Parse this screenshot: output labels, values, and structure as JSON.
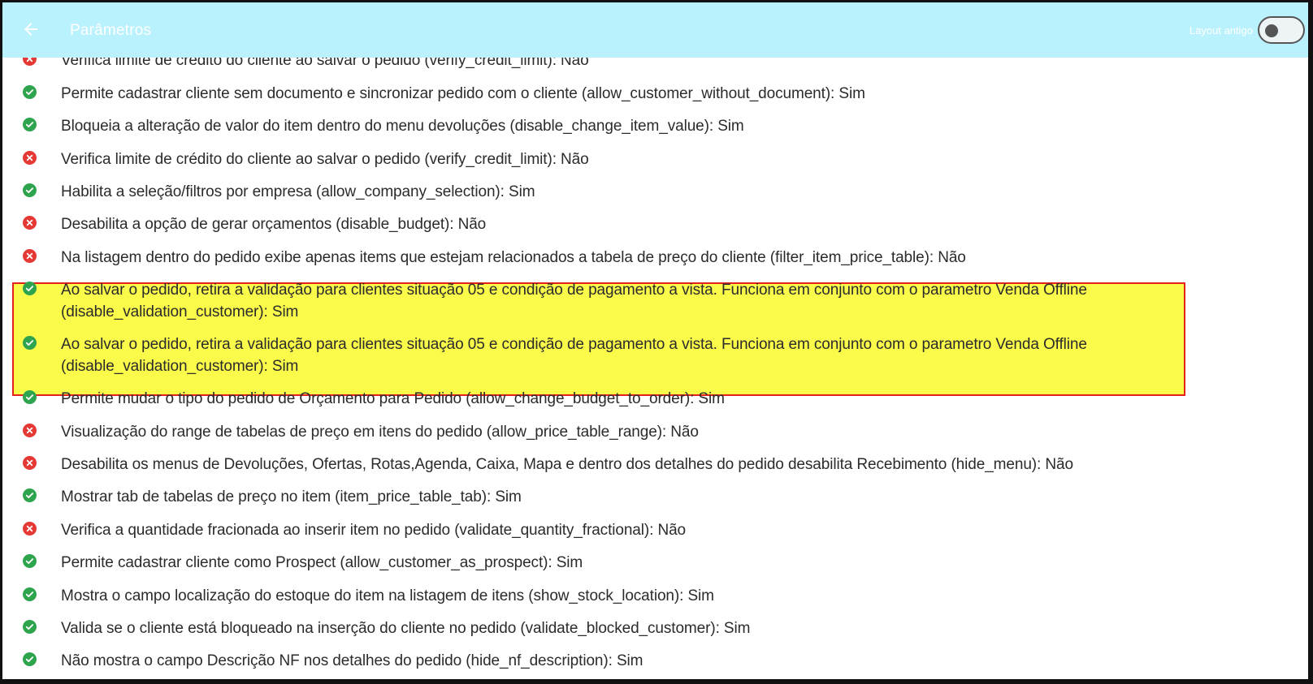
{
  "header": {
    "title": "Parâmetros",
    "toggle_label": "Layout antigo",
    "toggle_on": false
  },
  "colors": {
    "header_bg": "#b9f1fd",
    "ok": "#2fa44f",
    "no": "#e53935",
    "highlight_bg": "#fafa4a",
    "highlight_border": "#e3231b"
  },
  "params": [
    {
      "status": "no",
      "text": "Verifica limite de crédito do cliente ao salvar o pedido (verify_credit_limit): Não"
    },
    {
      "status": "ok",
      "text": "Permite cadastrar cliente sem documento e sincronizar pedido com o cliente (allow_customer_without_document): Sim"
    },
    {
      "status": "ok",
      "text": "Bloqueia a alteração de valor do item dentro do menu devoluções (disable_change_item_value): Sim"
    },
    {
      "status": "no",
      "text": "Verifica limite de crédito do cliente ao salvar o pedido (verify_credit_limit): Não"
    },
    {
      "status": "ok",
      "text": "Habilita a seleção/filtros por empresa (allow_company_selection): Sim"
    },
    {
      "status": "no",
      "text": "Desabilita a opção de gerar orçamentos (disable_budget): Não"
    },
    {
      "status": "no",
      "text": "Na listagem dentro do pedido exibe apenas items que estejam relacionados a tabela de preço do cliente (filter_item_price_table): Não"
    },
    {
      "status": "ok",
      "text": "Ao salvar o pedido, retira a validação para clientes situação 05 e condição de pagamento a vista. Funciona em conjunto com o parametro Venda Offline (disable_validation_customer): Sim"
    },
    {
      "status": "ok",
      "text": "Ao salvar o pedido, retira a validação para clientes situação 05 e condição de pagamento a vista. Funciona em conjunto com o parametro Venda Offline (disable_validation_customer): Sim"
    },
    {
      "status": "ok",
      "text": "Permite mudar o tipo do pedido de Orçamento para Pedido (allow_change_budget_to_order): Sim"
    },
    {
      "status": "no",
      "text": "Visualização do range de tabelas de preço em itens do pedido (allow_price_table_range): Não"
    },
    {
      "status": "no",
      "text": "Desabilita os menus de Devoluções, Ofertas, Rotas,Agenda, Caixa, Mapa e dentro dos detalhes do pedido desabilita Recebimento (hide_menu): Não"
    },
    {
      "status": "ok",
      "text": "Mostrar tab de tabelas de preço no item (item_price_table_tab): Sim"
    },
    {
      "status": "no",
      "text": "Verifica a quantidade fracionada ao inserir item no pedido (validate_quantity_fractional): Não"
    },
    {
      "status": "ok",
      "text": "Permite cadastrar cliente como Prospect (allow_customer_as_prospect): Sim"
    },
    {
      "status": "ok",
      "text": "Mostra o campo localização do estoque do item na listagem de itens (show_stock_location): Sim"
    },
    {
      "status": "ok",
      "text": "Valida se o cliente está bloqueado na inserção do cliente no pedido (validate_blocked_customer): Sim"
    },
    {
      "status": "ok",
      "text": "Não mostra o campo Descrição NF nos detalhes do pedido (hide_nf_description): Sim"
    }
  ]
}
